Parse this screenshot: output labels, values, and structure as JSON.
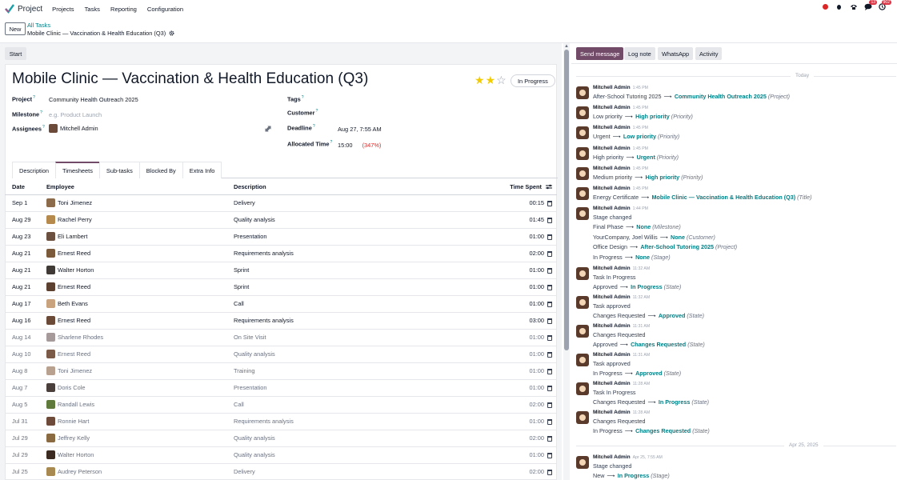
{
  "topnav": {
    "app_title": "Project",
    "menu": [
      "Projects",
      "Tasks",
      "Reporting",
      "Configuration"
    ],
    "badges": {
      "messages": "13",
      "activities": "902"
    }
  },
  "control": {
    "new_label": "New",
    "breadcrumb_parent": "All Tasks",
    "breadcrumb_current": "Mobile Clinic — Vaccination & Health Education (Q3)"
  },
  "form": {
    "start_label": "Start",
    "title": "Mobile Clinic — Vaccination & Health Education (Q3)",
    "priority_stars": 2,
    "state": "In Progress",
    "project_label": "Project",
    "project_value": "Community Health Outreach 2025",
    "milestone_label": "Milestone",
    "milestone_placeholder": "e.g. Product Launch",
    "assignees_label": "Assignees",
    "assignee": "Mitchell Admin",
    "tags_label": "Tags",
    "customer_label": "Customer",
    "deadline_label": "Deadline",
    "deadline_value": "Aug 27, 7:55 AM",
    "allocated_label": "Allocated Time",
    "allocated_value": "15:00",
    "allocated_pct": "(347%)"
  },
  "tabs": [
    "Description",
    "Timesheets",
    "Sub-tasks",
    "Blocked By",
    "Extra Info"
  ],
  "timesheet": {
    "headers": {
      "date": "Date",
      "employee": "Employee",
      "description": "Description",
      "time": "Time Spent"
    },
    "rows": [
      {
        "date": "Sep 1",
        "employee": "Toni Jimenez",
        "description": "Delivery",
        "time": "00:15",
        "faded": false
      },
      {
        "date": "Aug 29",
        "employee": "Rachel Perry",
        "description": "Quality analysis",
        "time": "01:45",
        "faded": false
      },
      {
        "date": "Aug 23",
        "employee": "Eli Lambert",
        "description": "Presentation",
        "time": "01:00",
        "faded": false
      },
      {
        "date": "Aug 21",
        "employee": "Ernest Reed",
        "description": "Requirements analysis",
        "time": "02:00",
        "faded": false
      },
      {
        "date": "Aug 21",
        "employee": "Walter Horton",
        "description": "Sprint",
        "time": "01:00",
        "faded": false
      },
      {
        "date": "Aug 21",
        "employee": "Ernest Reed",
        "description": "Sprint",
        "time": "01:00",
        "faded": false
      },
      {
        "date": "Aug 17",
        "employee": "Beth Evans",
        "description": "Call",
        "time": "01:00",
        "faded": false
      },
      {
        "date": "Aug 16",
        "employee": "Ernest Reed",
        "description": "Requirements analysis",
        "time": "03:00",
        "faded": false
      },
      {
        "date": "Aug 14",
        "employee": "Sharlene Rhodes",
        "description": "On Site Visit",
        "time": "01:00",
        "faded": true
      },
      {
        "date": "Aug 10",
        "employee": "Ernest Reed",
        "description": "Quality analysis",
        "time": "01:00",
        "faded": true
      },
      {
        "date": "Aug 8",
        "employee": "Toni Jimenez",
        "description": "Training",
        "time": "01:00",
        "faded": true
      },
      {
        "date": "Aug 7",
        "employee": "Doris Cole",
        "description": "Presentation",
        "time": "01:00",
        "faded": true
      },
      {
        "date": "Aug 5",
        "employee": "Randall Lewis",
        "description": "Call",
        "time": "02:00",
        "faded": true
      },
      {
        "date": "Jul 31",
        "employee": "Ronnie Hart",
        "description": "Requirements analysis",
        "time": "01:00",
        "faded": true
      },
      {
        "date": "Jul 29",
        "employee": "Jeffrey Kelly",
        "description": "Quality analysis",
        "time": "02:00",
        "faded": true
      },
      {
        "date": "Jul 29",
        "employee": "Walter Horton",
        "description": "Quality analysis",
        "time": "01:00",
        "faded": true
      },
      {
        "date": "Jul 25",
        "employee": "Audrey Peterson",
        "description": "Delivery",
        "time": "02:00",
        "faded": true
      }
    ]
  },
  "chatter": {
    "buttons": [
      "Send message",
      "Log note",
      "WhatsApp",
      "Activity"
    ],
    "separator_today": "Today",
    "separator_date": "Apr 25, 2025",
    "messages": [
      {
        "author": "Mitchell Admin",
        "time": "1:45 PM",
        "lines": [
          {
            "old": "After-School Tutoring 2025",
            "new": "Community Health Outreach 2025",
            "field": "(Project)"
          }
        ]
      },
      {
        "author": "Mitchell Admin",
        "time": "1:45 PM",
        "lines": [
          {
            "old": "Low priority",
            "new": "High priority",
            "field": "(Priority)"
          }
        ]
      },
      {
        "author": "Mitchell Admin",
        "time": "1:45 PM",
        "lines": [
          {
            "old": "Urgent",
            "new": "Low priority",
            "field": "(Priority)"
          }
        ]
      },
      {
        "author": "Mitchell Admin",
        "time": "1:45 PM",
        "lines": [
          {
            "old": "High priority",
            "new": "Urgent",
            "field": "(Priority)"
          }
        ]
      },
      {
        "author": "Mitchell Admin",
        "time": "1:45 PM",
        "lines": [
          {
            "old": "Medium priority",
            "new": "High priority",
            "field": "(Priority)"
          }
        ]
      },
      {
        "author": "Mitchell Admin",
        "time": "1:45 PM",
        "lines": [
          {
            "old": "Energy Certificate",
            "new": "Mobile Clinic — Vaccination & Health Education (Q3)",
            "field": "(Title)"
          }
        ]
      },
      {
        "author": "Mitchell Admin",
        "time": "1:44 PM",
        "body": "Stage changed",
        "lines": [
          {
            "old": "Final Phase",
            "new": "None",
            "field": "(Milestone)"
          },
          {
            "old": "YourCompany, Joel Willis",
            "new": "None",
            "field": "(Customer)"
          },
          {
            "old": "Office Design",
            "new": "After-School Tutoring 2025",
            "field": "(Project)"
          },
          {
            "old": "In Progress",
            "new": "None",
            "field": "(Stage)"
          }
        ]
      },
      {
        "author": "Mitchell Admin",
        "time": "11:32 AM",
        "body": "Task In Progress",
        "lines": [
          {
            "old": "Approved",
            "new": "In Progress",
            "field": "(State)"
          }
        ]
      },
      {
        "author": "Mitchell Admin",
        "time": "11:32 AM",
        "body": "Task approved",
        "lines": [
          {
            "old": "Changes Requested",
            "new": "Approved",
            "field": "(State)"
          }
        ]
      },
      {
        "author": "Mitchell Admin",
        "time": "11:31 AM",
        "body": "Changes Requested",
        "lines": [
          {
            "old": "Approved",
            "new": "Changes Requested",
            "field": "(State)"
          }
        ]
      },
      {
        "author": "Mitchell Admin",
        "time": "11:31 AM",
        "body": "Task approved",
        "lines": [
          {
            "old": "In Progress",
            "new": "Approved",
            "field": "(State)"
          }
        ]
      },
      {
        "author": "Mitchell Admin",
        "time": "11:28 AM",
        "body": "Task In Progress",
        "lines": [
          {
            "old": "Changes Requested",
            "new": "In Progress",
            "field": "(State)"
          }
        ]
      },
      {
        "author": "Mitchell Admin",
        "time": "11:28 AM",
        "body": "Changes Requested",
        "lines": [
          {
            "old": "In Progress",
            "new": "Changes Requested",
            "field": "(State)"
          }
        ]
      },
      {
        "author": "Mitchell Admin",
        "time": "Apr 25, 7:55 AM",
        "body": "Stage changed",
        "lines": [
          {
            "old": "New",
            "new": "In Progress",
            "field": "(Stage)"
          }
        ]
      }
    ]
  },
  "colors": {
    "accent": "#714b67",
    "link": "#017e84",
    "star": "#f3cc00"
  }
}
